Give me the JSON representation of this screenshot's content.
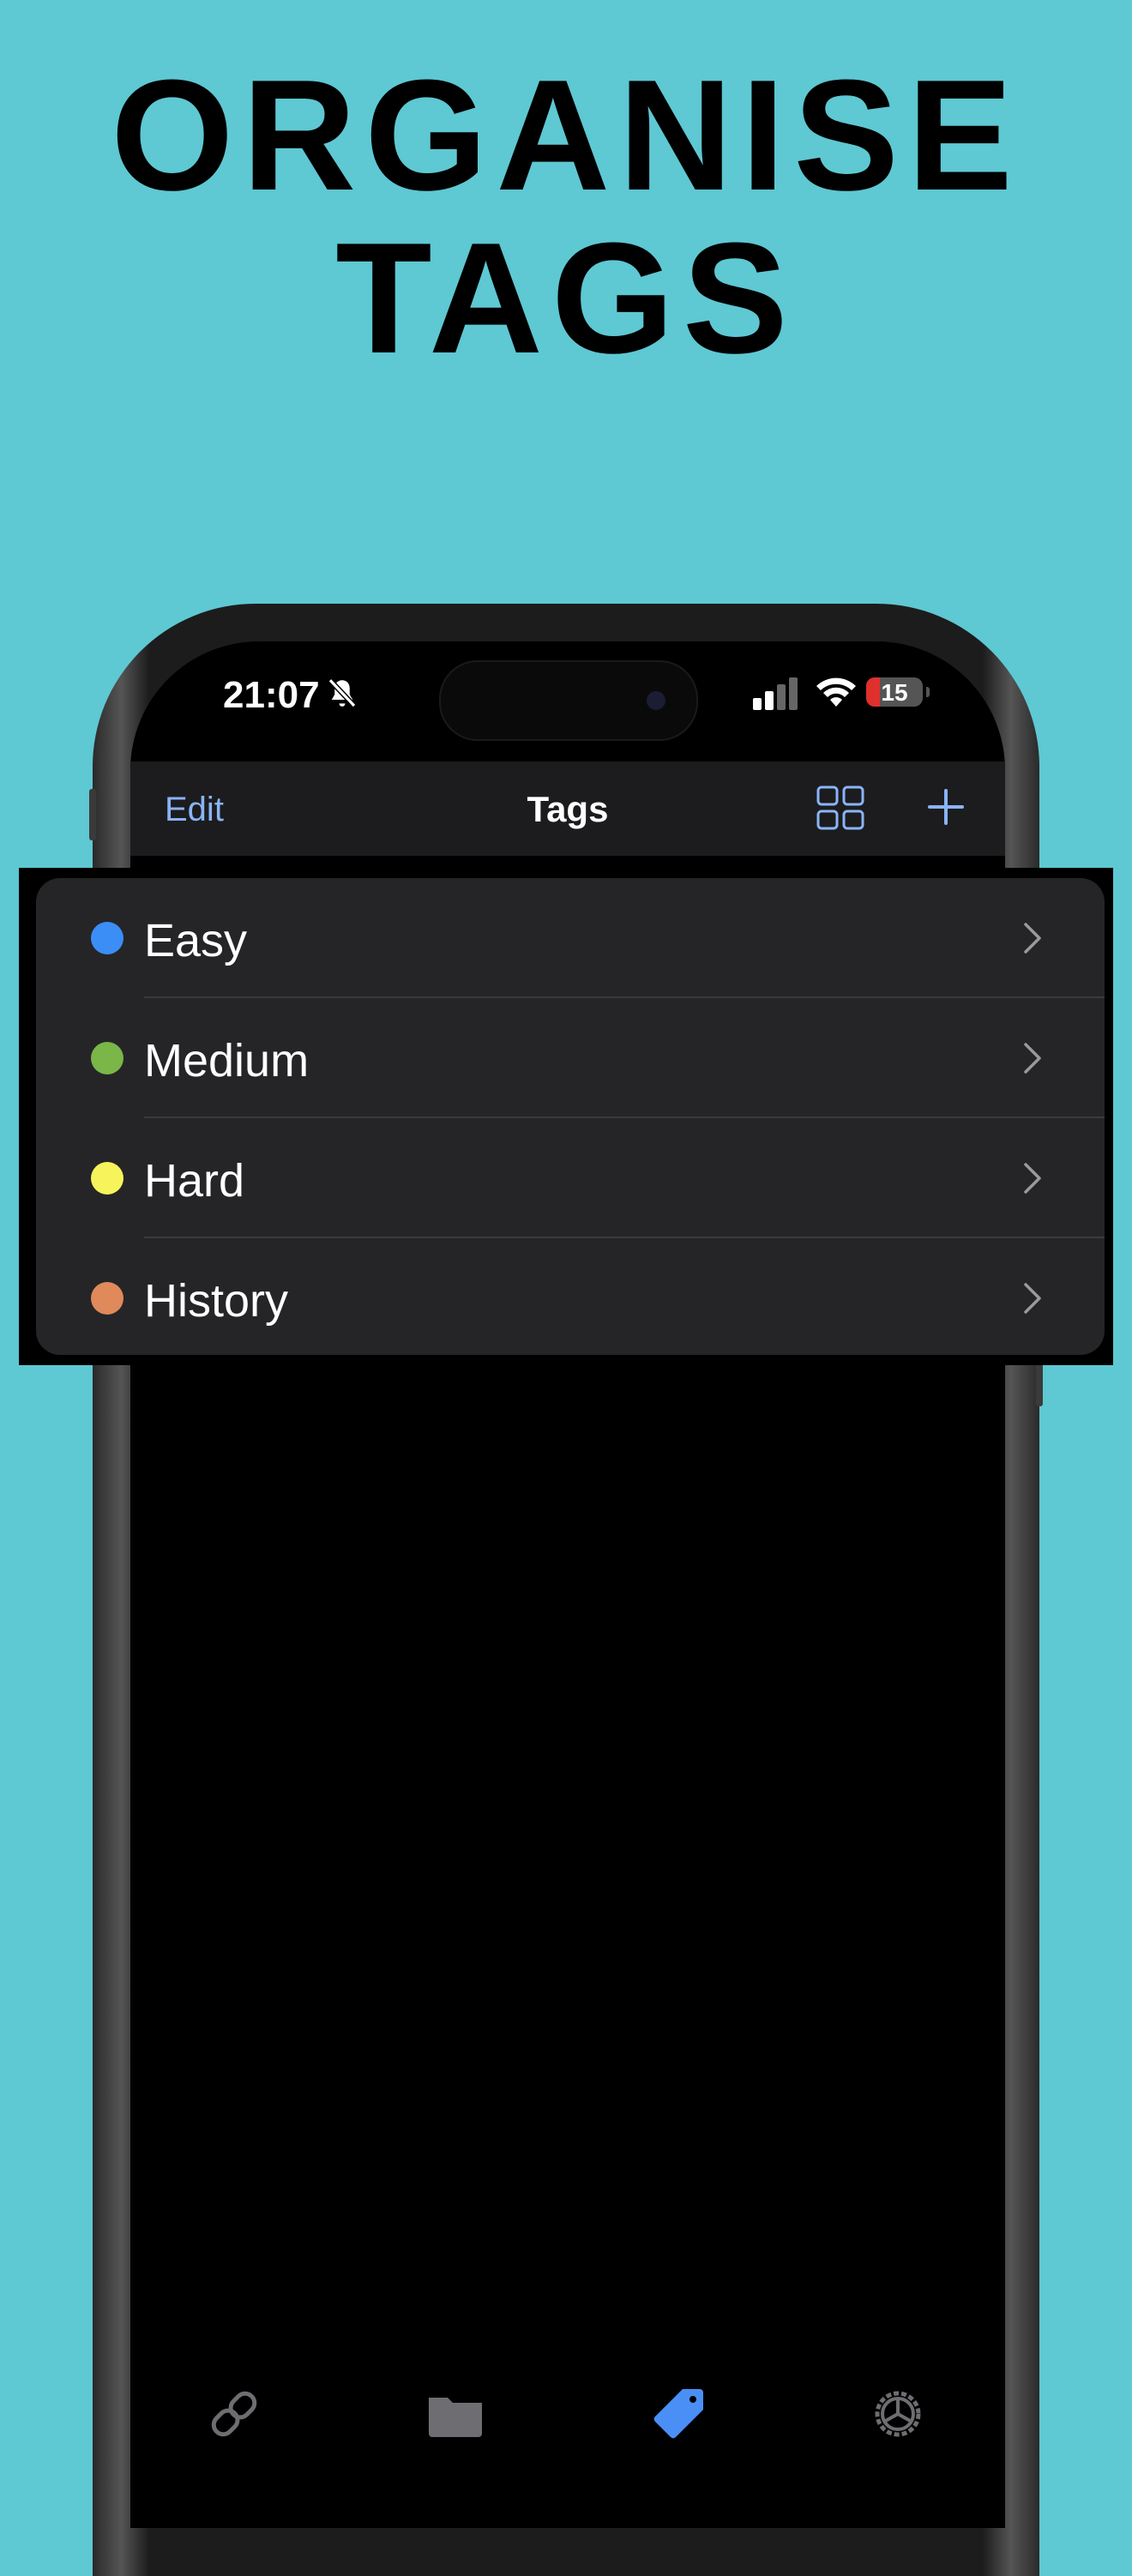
{
  "headline": {
    "line1": "ORGANISE",
    "line2": "TAGS"
  },
  "status_bar": {
    "time": "21:07",
    "battery": "15"
  },
  "nav": {
    "edit": "Edit",
    "title": "Tags"
  },
  "tags": [
    {
      "label": "Easy",
      "color": "#3a8ef6"
    },
    {
      "label": "Medium",
      "color": "#7ab648"
    },
    {
      "label": "Hard",
      "color": "#f7f35a"
    },
    {
      "label": "History",
      "color": "#e0895a"
    }
  ],
  "tab_bar": {
    "tabs": [
      {
        "icon": "link-icon",
        "active": false
      },
      {
        "icon": "folder-icon",
        "active": false
      },
      {
        "icon": "tag-icon",
        "active": true
      },
      {
        "icon": "settings-icon",
        "active": false
      }
    ]
  },
  "colors": {
    "background": "#5ec8d3",
    "accent": "#8ab4f8",
    "active_tab": "#4a8ff5"
  }
}
